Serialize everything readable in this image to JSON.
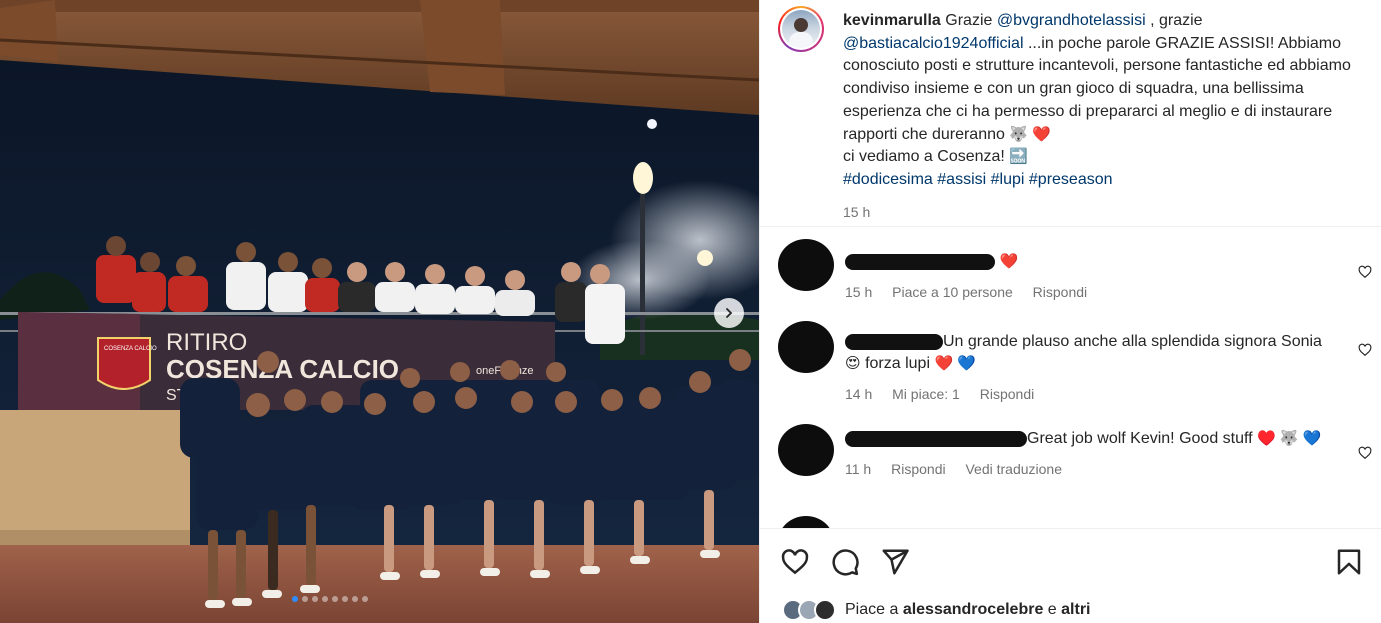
{
  "post": {
    "username": "kevinmarulla",
    "caption_parts": {
      "grazie1": "Grazie ",
      "mention1": "@bvgrandhotelassisi",
      "grazie2": " , grazie",
      "mention2": "@bastiacalcio1924official",
      "text1": " ...in poche parole GRAZIE ASSISI! Abbiamo conosciuto posti e strutture incantevoli, persone fantastiche ed abbiamo condiviso insieme e con un gran gioco di squadra, una bellissima esperienza che ci ha permesso di prepararci al meglio e di instaurare rapporti che dureranno",
      "emoji1": "🐺 ❤️",
      "text2": "ci vediamo a Cosenza! ",
      "emoji2": "🔜",
      "hashtags": [
        "#dodicesima",
        "#assisi",
        "#lupi",
        "#preseason"
      ]
    },
    "time": "15 h"
  },
  "photo": {
    "banner_line1": "RITIRO",
    "banner_line2": "COSENZA CALCIO",
    "banner_line3": "ST",
    "banner_partner": "oneFinanze",
    "crest_text": "COSENZA CALCIO",
    "slides": 8,
    "active_slide": 0
  },
  "comments": [
    {
      "text": "",
      "emoji": "❤️",
      "time": "15 h",
      "likes": "Piace a 10 persone",
      "reply": "Rispondi"
    },
    {
      "text": "Un grande plauso anche alla splendida signora Sonia",
      "emoji_a": "😍",
      "text_b": " forza lupi ",
      "emoji_b": "❤️ 💙",
      "time": "14 h",
      "likes": "Mi piace: 1",
      "reply": "Rispondi"
    },
    {
      "text": "Great job wolf Kevin! Good stuff ",
      "emoji": "♥️ 🐺 💙",
      "time": "11 h",
      "reply": "Rispondi",
      "translate": "Vedi traduzione"
    }
  ],
  "likes_summary": {
    "prefix": "Piace a ",
    "user": "alessandrocelebre",
    "middle": " e ",
    "others": "altri"
  },
  "icons": [
    "heart-icon",
    "comment-icon",
    "share-icon",
    "bookmark-icon",
    "chevron-right-icon"
  ],
  "colors": {
    "link": "#00376b",
    "secondary_text": "#737373",
    "active_dot": "#2f8cff"
  }
}
